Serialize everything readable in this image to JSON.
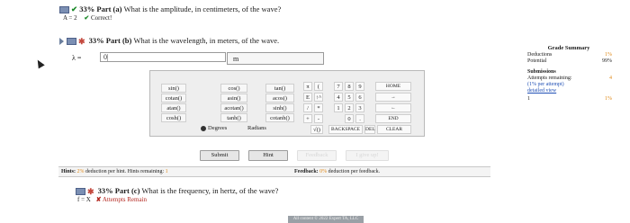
{
  "part_a": {
    "percent": "33%",
    "label": "Part (a)",
    "question": "What is the amplitude, in centimeters, of the wave?",
    "answer_line": "A = 2",
    "status": "Correct!"
  },
  "part_b": {
    "percent": "33%",
    "label": "Part (b)",
    "question": "What is the wavelength, in meters, of the wave.",
    "variable": "λ =",
    "input_value": "0|",
    "unit": "m"
  },
  "calculator": {
    "functions": [
      [
        "sin()",
        "cos()",
        "tan()"
      ],
      [
        "cotan()",
        "asin()",
        "acos()"
      ],
      [
        "atan()",
        "acotan()",
        "sinh()"
      ],
      [
        "cosh()",
        "tanh()",
        "cotanh()"
      ]
    ],
    "mode_selected": "Degrees",
    "mode_other": "Radians",
    "symbols": [
      "π",
      "(",
      "E",
      "↑^",
      "/",
      "*",
      "+",
      "-",
      "√()",
      "0",
      "."
    ],
    "digits": [
      "7",
      "8",
      "9",
      "4",
      "5",
      "6",
      "1",
      "2",
      "3"
    ],
    "home": "HOME",
    "end": "END",
    "backspace": "BACKSPACE",
    "del": "DEL",
    "clear": "CLEAR",
    "arrow_right": "→",
    "arrow_left": "←"
  },
  "actions": {
    "submit": "Submit",
    "hint": "Hint",
    "feedback": "Feedback",
    "give_up": "I give up!"
  },
  "hints_bar": {
    "hints_label": "Hints:",
    "hints_pct": "2%",
    "hints_text": "deduction per hint. Hints remaining:",
    "hints_remaining": "1",
    "feedback_label": "Feedback:",
    "feedback_pct": "0%",
    "feedback_text": "deduction per feedback."
  },
  "part_c": {
    "percent": "33%",
    "label": "Part (c)",
    "question": "What is the frequency, in hertz, of the wave?",
    "answer_line": "f = X",
    "status": "Attempts Remain"
  },
  "grade_summary": {
    "title": "Grade Summary",
    "deductions_label": "Deductions",
    "deductions_value": "1%",
    "potential_label": "Potential",
    "potential_value": "99%",
    "submissions_label": "Submissions",
    "attempts_label": "Attempts remaining:",
    "attempts_value": "4",
    "per_attempt": "(1% per attempt)",
    "detailed_view": "detailed view",
    "row_index": "1",
    "row_value": "1%"
  },
  "footer": {
    "text": "All content © 2022 Expert TA, LLC"
  },
  "colors": {
    "orange": "#e08a1a",
    "correct_green": "#1c8a2a",
    "wrong_red": "#b3261e"
  }
}
